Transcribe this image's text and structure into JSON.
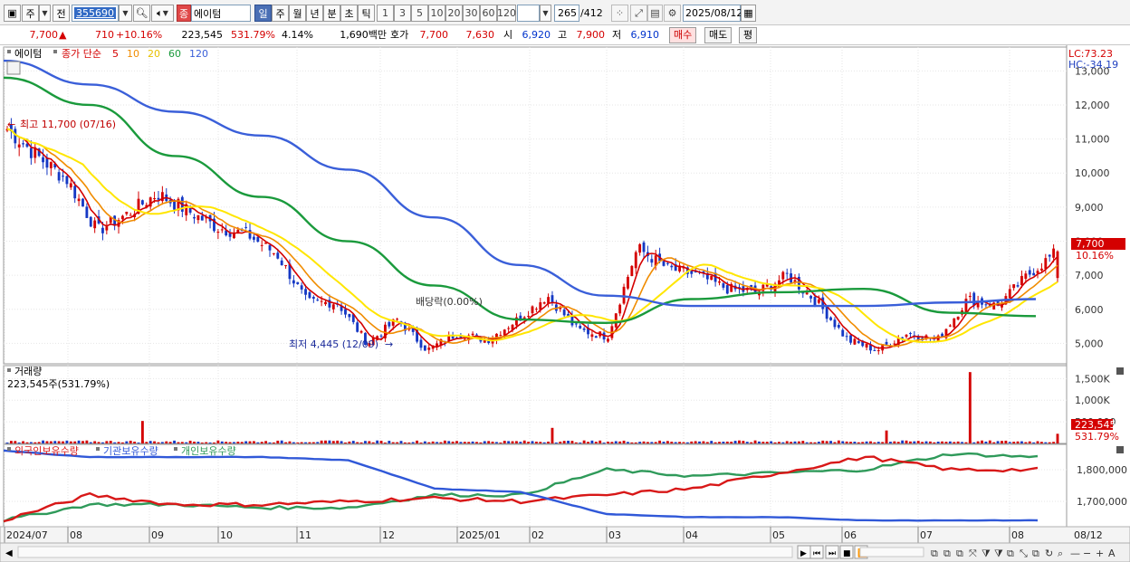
{
  "toolbar": {
    "mode_short": "주",
    "prev_short": "전",
    "stock_code": "355690",
    "stock_name_badge": "종",
    "stock_name": "에이텀",
    "periods": [
      "일",
      "주",
      "월",
      "년",
      "분",
      "초",
      "틱"
    ],
    "active_period": "일",
    "intervals": [
      "1",
      "3",
      "5",
      "10",
      "20",
      "30",
      "60",
      "120"
    ],
    "count": "265",
    "count_total": "/412",
    "date": "2025/08/12"
  },
  "quote": {
    "price": "7,700",
    "change": "710",
    "change_pct": "+10.16%",
    "volume": "223,545",
    "volume_ratio": "531.79%",
    "turnover": "4.14%",
    "amount": "1,690백만",
    "hoga_label": "호가",
    "ask": "7,700",
    "bid": "7,630",
    "open_label": "시",
    "open": "6,920",
    "high_label": "고",
    "high": "7,900",
    "low_label": "저",
    "low": "6,910",
    "buy_label": "매수",
    "sell_label": "매도",
    "eval_label": "평"
  },
  "price_panel": {
    "name": "에이텀",
    "ma_label": "종가 단순",
    "ma_periods": [
      "5",
      "10",
      "20",
      "60",
      "120"
    ],
    "lc": "LC:73.23",
    "hc": "HC:-34.19",
    "y_ticks": [
      "13,000",
      "12,000",
      "11,000",
      "10,000",
      "9,000",
      "8,000",
      "7,000",
      "6,000",
      "5,000"
    ],
    "high_annotation": "최고 11,700 (07/16)",
    "low_annotation": "최저 4,445 (12/09)",
    "dividend_annotation": "배당락(0.00%)",
    "last_price": "7,700",
    "last_pct": "10.16%"
  },
  "volume_panel": {
    "title": "거래량",
    "info": "223,545주(531.79%)",
    "y_ticks": [
      "1,500K",
      "1,000K",
      "500,000"
    ],
    "last_volume": "223,545",
    "last_pct": "531.79%"
  },
  "holdings_panel": {
    "legend": [
      "외국인보유수량",
      "기관보유수량",
      "개인보유수량"
    ],
    "y_ticks": [
      "1,800,000",
      "1,700,000"
    ]
  },
  "x_axis": {
    "labels": [
      "2024/07",
      "08",
      "09",
      "10",
      "11",
      "12",
      "2025/01",
      "02",
      "03",
      "04",
      "05",
      "06",
      "07",
      "08"
    ],
    "right_label": "08/12"
  },
  "colors": {
    "up": "#d40000",
    "down": "#1538c4",
    "ma5": "#d40000",
    "ma10": "#f08c00",
    "ma20": "#ffe600",
    "ma60": "#1a9a3c",
    "ma120": "#3a5fd9",
    "foreign": "#d81818",
    "institution": "#3058d8",
    "individual": "#2f9a5a"
  },
  "chart_data": {
    "type": "candlestick",
    "x": [
      "2024/07",
      "08",
      "09",
      "10",
      "11",
      "12",
      "2025/01",
      "02",
      "03",
      "04",
      "05",
      "06",
      "07",
      "08"
    ],
    "close_series": [
      {
        "date": "2024/07",
        "close": 11300
      },
      {
        "date": "2024/07",
        "close": 10500
      },
      {
        "date": "2024/08",
        "close": 9800
      },
      {
        "date": "2024/08",
        "close": 8300
      },
      {
        "date": "2024/08",
        "close": 8800
      },
      {
        "date": "2024/09",
        "close": 9400
      },
      {
        "date": "2024/09",
        "close": 8900
      },
      {
        "date": "2024/10",
        "close": 8400
      },
      {
        "date": "2024/10",
        "close": 8200
      },
      {
        "date": "2024/10",
        "close": 7600
      },
      {
        "date": "2024/11",
        "close": 6200
      },
      {
        "date": "2024/11",
        "close": 6200
      },
      {
        "date": "2024/11",
        "close": 5000
      },
      {
        "date": "2024/12",
        "close": 5700
      },
      {
        "date": "2024/12",
        "close": 4800
      },
      {
        "date": "2024/12",
        "close": 5300
      },
      {
        "date": "2025/01",
        "close": 5100
      },
      {
        "date": "2025/01",
        "close": 5700
      },
      {
        "date": "2025/01",
        "close": 6400
      },
      {
        "date": "2025/02",
        "close": 5400
      },
      {
        "date": "2025/02",
        "close": 5200
      },
      {
        "date": "2025/03",
        "close": 7800
      },
      {
        "date": "2025/03",
        "close": 7200
      },
      {
        "date": "2025/03",
        "close": 7000
      },
      {
        "date": "2025/04",
        "close": 6600
      },
      {
        "date": "2025/04",
        "close": 6500
      },
      {
        "date": "2025/05",
        "close": 7000
      },
      {
        "date": "2025/05",
        "close": 6200
      },
      {
        "date": "2025/06",
        "close": 5100
      },
      {
        "date": "2025/06",
        "close": 4800
      },
      {
        "date": "2025/07",
        "close": 5300
      },
      {
        "date": "2025/07",
        "close": 5100
      },
      {
        "date": "2025/07",
        "close": 6300
      },
      {
        "date": "2025/08",
        "close": 6100
      },
      {
        "date": "2025/08",
        "close": 7000
      },
      {
        "date": "2025/08/12",
        "close": 7700
      }
    ],
    "ylim": [
      4400,
      13700
    ],
    "ma120": [
      13300,
      12600,
      11800,
      11100,
      10100,
      8700,
      7300,
      6400,
      6100,
      6100,
      6100,
      6200,
      6300
    ],
    "ma60": [
      12800,
      12000,
      10500,
      9300,
      8000,
      6700,
      5700,
      5600,
      6300,
      6500,
      6600,
      5900,
      5800
    ],
    "volume_ylim": [
      0,
      1800000
    ],
    "volume_spikes": [
      {
        "date": "2024/08",
        "value": 520000
      },
      {
        "date": "2025/01",
        "value": 360000
      },
      {
        "date": "2025/06",
        "value": 300000
      },
      {
        "date": "2025/08",
        "value": 1650000
      },
      {
        "date": "2025/08/12",
        "value": 223545
      }
    ],
    "holdings_ylim": [
      1620000,
      1880000
    ],
    "foreign": [
      1640000,
      1720000,
      1690000,
      1690000,
      1700000,
      1710000,
      1700000,
      1720000,
      1740000,
      1790000,
      1840000,
      1800000,
      1800000
    ],
    "institution": [
      1860000,
      1840000,
      1840000,
      1840000,
      1830000,
      1740000,
      1730000,
      1660000,
      1650000,
      1650000,
      1640000,
      1640000,
      1640000
    ],
    "individual": [
      1640000,
      1690000,
      1690000,
      1680000,
      1680000,
      1720000,
      1720000,
      1800000,
      1780000,
      1790000,
      1800000,
      1850000,
      1840000
    ]
  }
}
